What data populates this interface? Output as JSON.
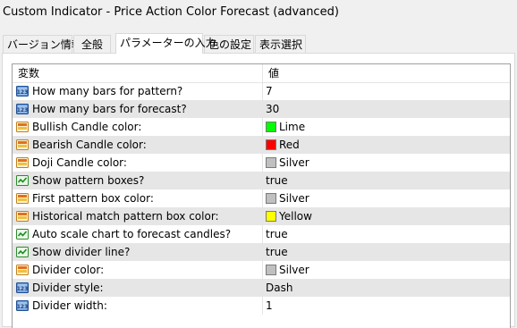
{
  "window": {
    "title": "Custom Indicator - Price Action Color Forecast (advanced)"
  },
  "tabs": [
    {
      "label": "バージョン情報"
    },
    {
      "label": "全般"
    },
    {
      "label": "パラメーターの入力",
      "active": true
    },
    {
      "label": "色の設定"
    },
    {
      "label": "表示選択"
    }
  ],
  "grid": {
    "header": {
      "name": "変数",
      "value": "値"
    },
    "rows": [
      {
        "icon": "int-icon",
        "label": "How many bars for pattern?",
        "value": "7"
      },
      {
        "icon": "int-icon",
        "label": "How many bars for forecast?",
        "value": "30"
      },
      {
        "icon": "color-icon",
        "label": "Bullish Candle color:",
        "value": "Lime",
        "swatch": "#00ff00"
      },
      {
        "icon": "color-icon",
        "label": "Bearish Candle color:",
        "value": "Red",
        "swatch": "#ff0000"
      },
      {
        "icon": "color-icon",
        "label": "Doji Candle color:",
        "value": "Silver",
        "swatch": "#c0c0c0"
      },
      {
        "icon": "bool-icon",
        "label": "Show pattern boxes?",
        "value": "true"
      },
      {
        "icon": "color-icon",
        "label": "First pattern box color:",
        "value": "Silver",
        "swatch": "#c0c0c0"
      },
      {
        "icon": "color-icon",
        "label": "Historical match pattern box color:",
        "value": "Yellow",
        "swatch": "#ffff00"
      },
      {
        "icon": "bool-icon",
        "label": "Auto scale chart to forecast candles?",
        "value": "true"
      },
      {
        "icon": "bool-icon",
        "label": "Show divider line?",
        "value": "true"
      },
      {
        "icon": "color-icon",
        "label": "Divider color:",
        "value": "Silver",
        "swatch": "#c0c0c0"
      },
      {
        "icon": "int-icon",
        "label": "Divider style:",
        "value": "Dash"
      },
      {
        "icon": "int-icon",
        "label": "Divider width:",
        "value": "1"
      }
    ]
  },
  "colors": {
    "row_shade": "#e6e6e6",
    "grid_border": "#a0a0a0"
  }
}
